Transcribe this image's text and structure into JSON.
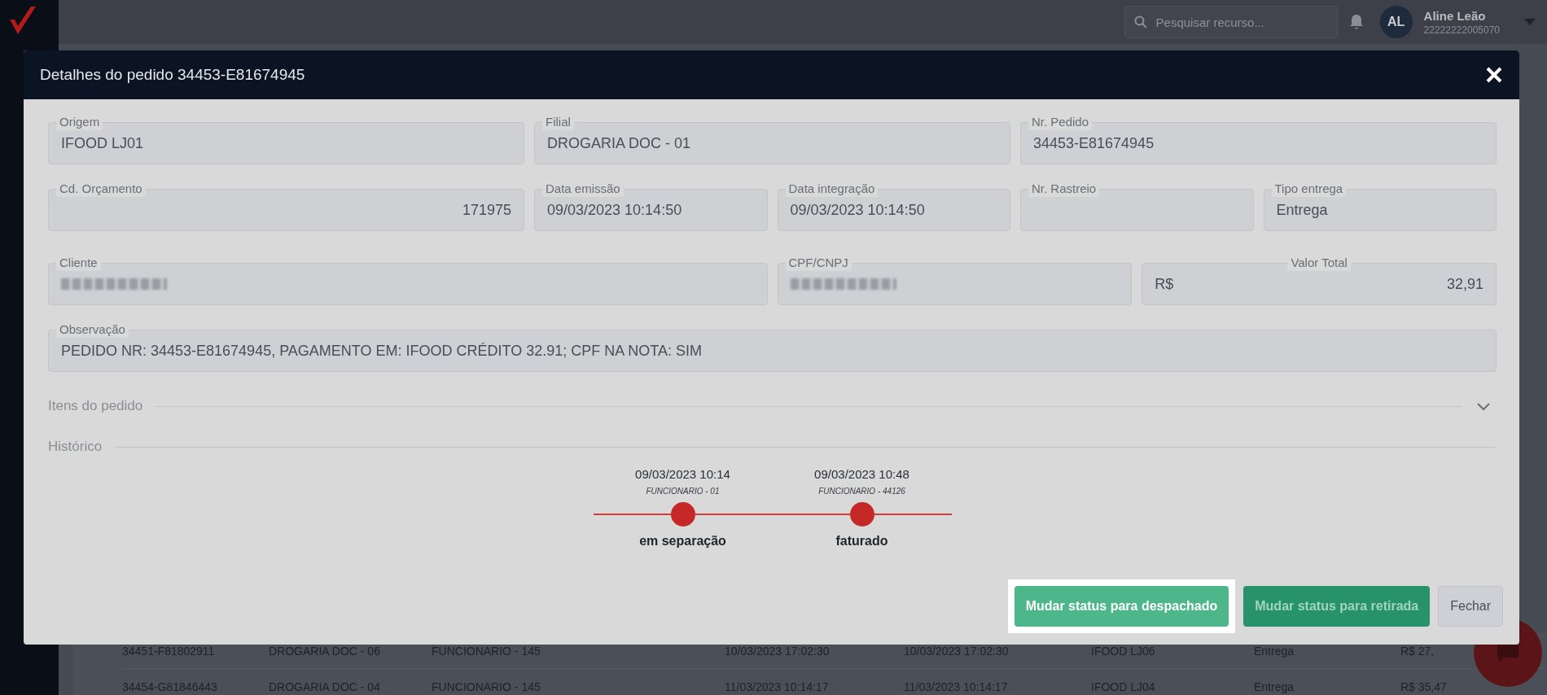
{
  "topbar": {
    "search": {
      "placeholder": "Pesquisar recurso..."
    },
    "user": {
      "initials": "AL",
      "name": "Aline Leão",
      "code": "22222222005070"
    }
  },
  "dialog": {
    "title": "Detalhes do pedido 34453-E81674945",
    "field_rows": [
      [
        {
          "label": "Origem",
          "value": "IFOOD LJ01",
          "kind": "text"
        },
        {
          "label": "Filial",
          "value": "DROGARIA DOC - 01",
          "kind": "text"
        },
        {
          "label": "Nr. Pedido",
          "value": "34453-E81674945",
          "kind": "text"
        }
      ],
      [
        {
          "label": "Cd. Orçamento",
          "value": "171975",
          "kind": "number"
        },
        {
          "label": "Data emissão",
          "value": "09/03/2023 10:14:50",
          "kind": "text"
        },
        {
          "label": "Data integração",
          "value": "09/03/2023 10:14:50",
          "kind": "text"
        },
        {
          "label": "Nr. Rastreio",
          "kind": "text"
        },
        {
          "label": "Tipo entrega",
          "value": "Entrega",
          "kind": "text"
        }
      ],
      [
        {
          "label": "Cliente",
          "kind": "redacted"
        },
        {
          "label": "CPF/CNPJ",
          "kind": "redacted"
        },
        {
          "label": "Valor Total",
          "prefix": "R$",
          "value": "32,91",
          "kind": "currency"
        }
      ],
      [
        {
          "label": "Observação",
          "value": "PEDIDO NR: 34453-E81674945, PAGAMENTO EM: IFOOD CRÉDITO 32.91; CPF NA NOTA: SIM",
          "kind": "text"
        }
      ]
    ],
    "sections": [
      {
        "title": "Itens do pedido",
        "kind": "collapsible",
        "expanded": false
      },
      {
        "title": "Histórico",
        "kind": "timeline"
      }
    ],
    "history": [
      {
        "time": "09/03/2023 10:14",
        "user": "FUNCIONARIO - 01",
        "status": "em separação"
      },
      {
        "time": "09/03/2023 10:48",
        "user": "FUNCIONARIO - 44126",
        "status": "faturado"
      }
    ],
    "buttons": [
      {
        "label": "Mudar status para despachado",
        "kind": "success-light",
        "highlighted": true
      },
      {
        "label": "Mudar status para retirada",
        "kind": "success",
        "highlighted": false
      },
      {
        "label": "Fechar",
        "kind": "neutral",
        "highlighted": false
      }
    ]
  },
  "background_table": {
    "rows": [
      [
        "34451-F81802911",
        "DROGARIA DOC - 06",
        "FUNCIONARIO - 145",
        "10/03/2023 17:02:30",
        "10/03/2023 17:02:30",
        "IFOOD LJ06",
        "Entrega",
        "R$ 27,"
      ],
      [
        "34454-G81846443",
        "DROGARIA DOC - 04",
        "FUNCIONARIO - 145",
        "11/03/2023 10:14:17",
        "11/03/2023 10:14:17",
        "IFOOD LJ04",
        "Entrega",
        "R$ 35,47"
      ]
    ]
  }
}
